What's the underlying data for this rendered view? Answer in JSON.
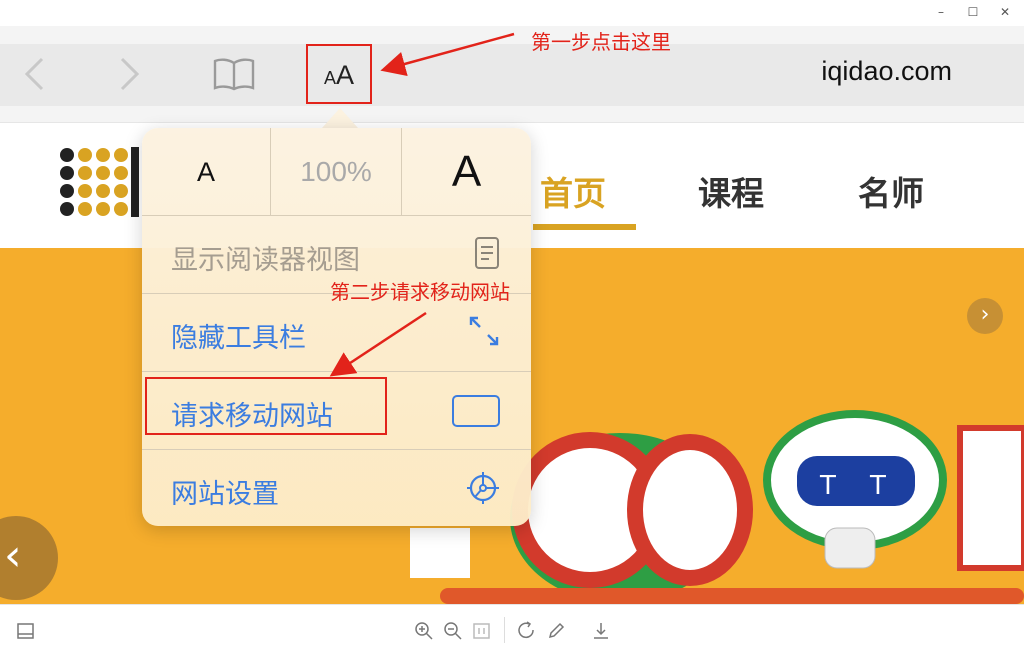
{
  "window": {
    "title": "",
    "minimize": "–",
    "maximize": "☐",
    "close": "✕"
  },
  "toolbar": {
    "back_icon": "chevron-left-icon",
    "forward_icon": "chevron-right-icon",
    "bookmarks_icon": "book-icon",
    "text_size_small": "A",
    "text_size_large": "A",
    "url": "iqidao.com"
  },
  "site": {
    "nav": {
      "home": "首页",
      "course": "课程",
      "teacher": "名师"
    },
    "brand_color": "#d9a322",
    "banner_color": "#f5ad2c",
    "banner_next": "›",
    "banner_prev": "‹"
  },
  "popover": {
    "font_smaller": "A",
    "font_size": "100%",
    "font_larger": "A",
    "items": [
      {
        "label": "显示阅读器视图",
        "icon": "reader-view-icon",
        "enabled": false
      },
      {
        "label": "隐藏工具栏",
        "icon": "expand-arrows-icon",
        "enabled": true
      },
      {
        "label": "请求移动网站",
        "icon": "mobile-site-icon",
        "enabled": true
      },
      {
        "label": "网站设置",
        "icon": "settings-icon",
        "enabled": true
      }
    ],
    "item_color": "#3b7de0"
  },
  "annotations": {
    "step1": "第一步点击这里",
    "step2": "第二步请求移动网站",
    "color": "#e2231a"
  },
  "bottombar": {
    "icons": [
      "sidebar-icon",
      "zoom-in-icon",
      "zoom-out-icon",
      "fit-page-icon",
      "refresh-icon",
      "edit-icon",
      "download-icon"
    ]
  }
}
